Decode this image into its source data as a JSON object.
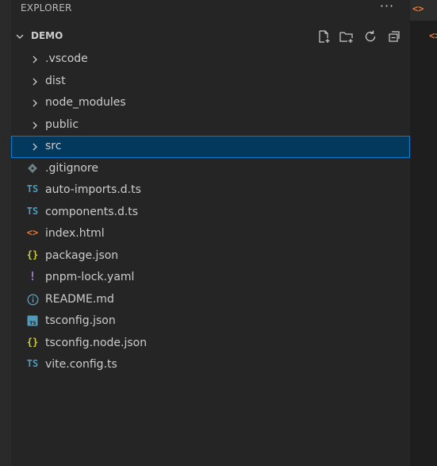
{
  "panel": {
    "title": "EXPLORER",
    "more_icon": "ellipsis-icon"
  },
  "section": {
    "title": "DEMO",
    "actions": [
      "new-file-icon",
      "new-folder-icon",
      "refresh-icon",
      "collapse-all-icon"
    ]
  },
  "tree": {
    "items": [
      {
        "label": ".vscode",
        "kind": "folder"
      },
      {
        "label": "dist",
        "kind": "folder"
      },
      {
        "label": "node_modules",
        "kind": "folder"
      },
      {
        "label": "public",
        "kind": "folder"
      },
      {
        "label": "src",
        "kind": "folder",
        "selected": true
      },
      {
        "label": ".gitignore",
        "kind": "file",
        "icon": "git-icon",
        "color": "#6d8086"
      },
      {
        "label": "auto-imports.d.ts",
        "kind": "file",
        "icon_text": "TS",
        "color": "#519aba"
      },
      {
        "label": "components.d.ts",
        "kind": "file",
        "icon_text": "TS",
        "color": "#519aba"
      },
      {
        "label": "index.html",
        "kind": "file",
        "icon_text": "<>",
        "color": "#e37933"
      },
      {
        "label": "package.json",
        "kind": "file",
        "icon_text": "{}",
        "color": "#cbcb41"
      },
      {
        "label": "pnpm-lock.yaml",
        "kind": "file",
        "icon_text": "!",
        "color": "#a074c4"
      },
      {
        "label": "README.md",
        "kind": "file",
        "icon": "info-icon",
        "color": "#519aba"
      },
      {
        "label": "tsconfig.json",
        "kind": "file",
        "icon": "ts-config-icon",
        "color": "#519aba"
      },
      {
        "label": "tsconfig.node.json",
        "kind": "file",
        "icon_text": "{}",
        "color": "#cbcb41"
      },
      {
        "label": "vite.config.ts",
        "kind": "file",
        "icon_text": "TS",
        "color": "#519aba"
      }
    ]
  },
  "editor": {
    "tab_icon_text": "<>",
    "tab_icon_color": "#e37933"
  },
  "colors": {
    "sidebar_bg": "#252526",
    "selection_bg": "#04395e",
    "selection_border": "#007fd4"
  }
}
